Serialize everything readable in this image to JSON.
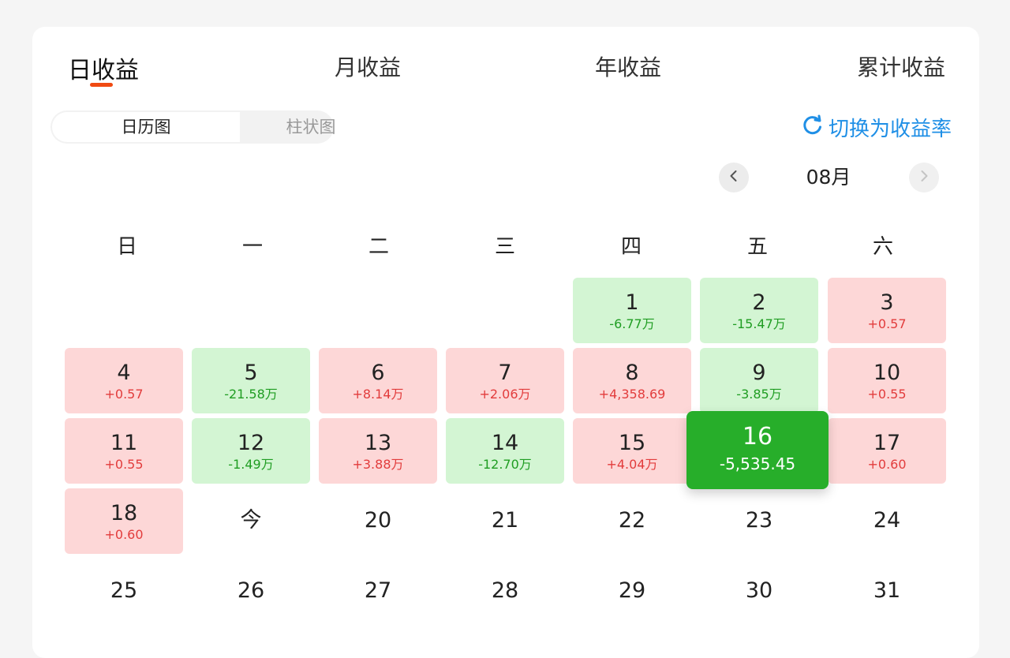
{
  "tabs": [
    {
      "label": "日收益",
      "active": true
    },
    {
      "label": "月收益",
      "active": false
    },
    {
      "label": "年收益",
      "active": false
    },
    {
      "label": "累计收益",
      "active": false
    }
  ],
  "view_toggle": {
    "calendar": "日历图",
    "bar": "柱状图",
    "selected": "calendar"
  },
  "switch_link": {
    "label": "切换为收益率",
    "icon": "refresh-icon"
  },
  "month_nav": {
    "month": "08月",
    "prev_icon": "chevron-left-icon",
    "next_icon": "chevron-right-icon"
  },
  "weekdays": [
    "日",
    "一",
    "二",
    "三",
    "四",
    "五",
    "六"
  ],
  "colors": {
    "accent": "#f04a12",
    "gain_bg": "#fdd7d7",
    "gain_text": "#e23c3c",
    "loss_bg": "#d3f5d3",
    "loss_text": "#1f9d22",
    "selected": "#27ae2a",
    "link": "#1f8fe6"
  },
  "days": [
    {
      "day": "1",
      "value": "-6.77万",
      "status": "down"
    },
    {
      "day": "2",
      "value": "-15.47万",
      "status": "down"
    },
    {
      "day": "3",
      "value": "+0.57",
      "status": "up"
    },
    {
      "day": "4",
      "value": "+0.57",
      "status": "up"
    },
    {
      "day": "5",
      "value": "-21.58万",
      "status": "down"
    },
    {
      "day": "6",
      "value": "+8.14万",
      "status": "up"
    },
    {
      "day": "7",
      "value": "+2.06万",
      "status": "up"
    },
    {
      "day": "8",
      "value": "+4,358.69",
      "status": "up"
    },
    {
      "day": "9",
      "value": "-3.85万",
      "status": "down"
    },
    {
      "day": "10",
      "value": "+0.55",
      "status": "up"
    },
    {
      "day": "11",
      "value": "+0.55",
      "status": "up"
    },
    {
      "day": "12",
      "value": "-1.49万",
      "status": "down"
    },
    {
      "day": "13",
      "value": "+3.88万",
      "status": "up"
    },
    {
      "day": "14",
      "value": "-12.70万",
      "status": "down"
    },
    {
      "day": "15",
      "value": "+4.04万",
      "status": "up"
    },
    {
      "day": "16",
      "value": "-5,535.45",
      "status": "selected"
    },
    {
      "day": "17",
      "value": "+0.60",
      "status": "up"
    },
    {
      "day": "18",
      "value": "+0.60",
      "status": "up"
    },
    {
      "day": "今",
      "value": "",
      "status": "plain"
    },
    {
      "day": "20",
      "value": "",
      "status": "plain"
    },
    {
      "day": "21",
      "value": "",
      "status": "plain"
    },
    {
      "day": "22",
      "value": "",
      "status": "plain"
    },
    {
      "day": "23",
      "value": "",
      "status": "plain"
    },
    {
      "day": "24",
      "value": "",
      "status": "plain"
    },
    {
      "day": "25",
      "value": "",
      "status": "plain"
    },
    {
      "day": "26",
      "value": "",
      "status": "plain"
    },
    {
      "day": "27",
      "value": "",
      "status": "plain"
    },
    {
      "day": "28",
      "value": "",
      "status": "plain"
    },
    {
      "day": "29",
      "value": "",
      "status": "plain"
    },
    {
      "day": "30",
      "value": "",
      "status": "plain"
    },
    {
      "day": "31",
      "value": "",
      "status": "plain"
    }
  ]
}
